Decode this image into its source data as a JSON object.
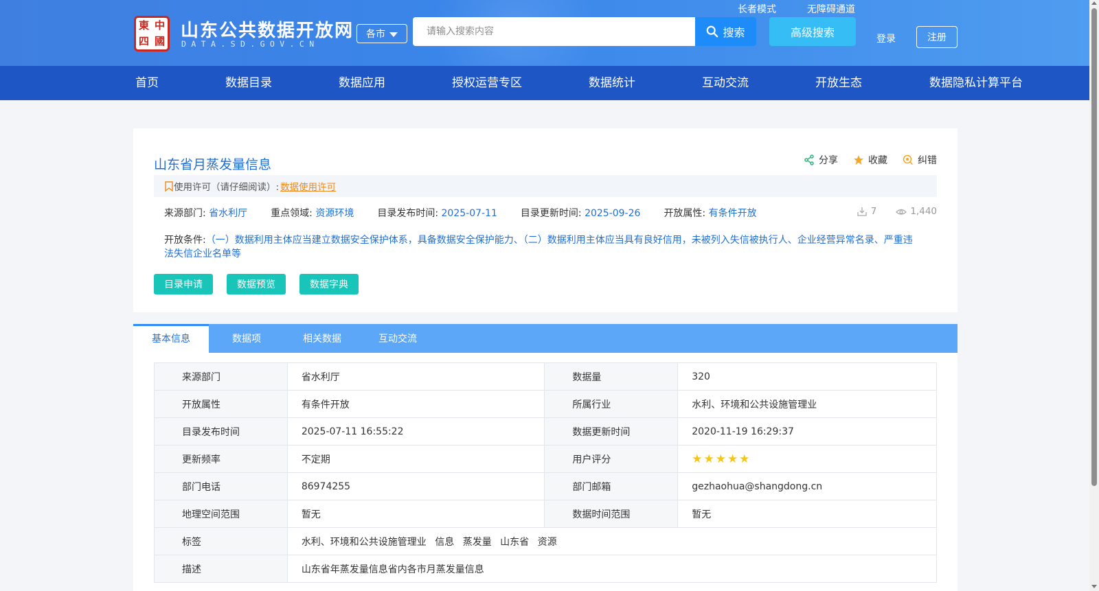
{
  "header": {
    "logo_chars": [
      "中",
      "國",
      "四",
      "東"
    ],
    "site_title": "山东公共数据开放网",
    "site_subtitle": "DATA.SD.GOV.CN",
    "city_select": "各市",
    "search_placeholder": "请输入搜索内容",
    "search_label": "搜索",
    "advanced_search": "高级搜索",
    "elder_mode": "长者模式",
    "accessibility": "无障碍通道",
    "login": "登录",
    "register": "注册"
  },
  "nav": [
    {
      "label": "首页"
    },
    {
      "label": "数据目录"
    },
    {
      "label": "数据应用"
    },
    {
      "label": "授权运营专区"
    },
    {
      "label": "数据统计"
    },
    {
      "label": "互动交流"
    },
    {
      "label": "开放生态"
    },
    {
      "label": "数据隐私计算平台"
    }
  ],
  "dataset": {
    "title": "山东省月蒸发量信息",
    "share": "分享",
    "favorite": "收藏",
    "report": "纠错",
    "license_label": "使用许可（请仔细阅读）:",
    "license_link": "数据使用许可",
    "source_label": "来源部门:",
    "source": "省水利厅",
    "domain_label": "重点领域:",
    "domain": "资源环境",
    "publish_label": "目录发布时间:",
    "publish_date": "2025-07-11",
    "update_label": "目录更新时间:",
    "update_date": "2025-09-26",
    "open_label": "开放属性:",
    "open_attr": "有条件开放",
    "downloads": "7",
    "views": "1,440",
    "condition_label": "开放条件:",
    "condition": "（一）数据利用主体应当建立数据安全保护体系，具备数据安全保护能力、（二）数据利用主体应当具有良好信用，未被列入失信被执行人、企业经营异常名录、严重违法失信企业名单等",
    "buttons": {
      "apply": "目录申请",
      "preview": "数据预览",
      "dictionary": "数据字典"
    }
  },
  "tabs": [
    {
      "label": "基本信息"
    },
    {
      "label": "数据项"
    },
    {
      "label": "相关数据"
    },
    {
      "label": "互动交流"
    }
  ],
  "info": {
    "source_dept_label": "来源部门",
    "source_dept": "省水利厅",
    "data_volume_label": "数据量",
    "data_volume": "320",
    "open_attr_label": "开放属性",
    "open_attr": "有条件开放",
    "industry_label": "所属行业",
    "industry": "水利、环境和公共设施管理业",
    "publish_time_label": "目录发布时间",
    "publish_time": "2025-07-11 16:55:22",
    "data_update_label": "数据更新时间",
    "data_update": "2020-11-19 16:29:37",
    "frequency_label": "更新频率",
    "frequency": "不定期",
    "rating_label": "用户评分",
    "rating": 5,
    "phone_label": "部门电话",
    "phone": "86974255",
    "email_label": "部门邮箱",
    "email": "gezhaohua@shangdong.cn",
    "geo_label": "地理空间范围",
    "geo": "暂无",
    "time_range_label": "数据时间范围",
    "time_range": "暂无",
    "tags_label": "标签",
    "tags": [
      "水利、环境和公共设施管理业",
      "信息",
      "蒸发量",
      "山东省",
      "资源"
    ],
    "desc_label": "描述",
    "desc": "山东省年蒸发量信息省内各市月蒸发量信息"
  },
  "colors": {
    "header_blue": "#3a86ea",
    "nav_blue": "#1f56c6",
    "link_blue": "#1f6fd6",
    "teal": "#19c4b8",
    "orange": "#f08a1a",
    "tab_blue": "#5ca7f8"
  }
}
